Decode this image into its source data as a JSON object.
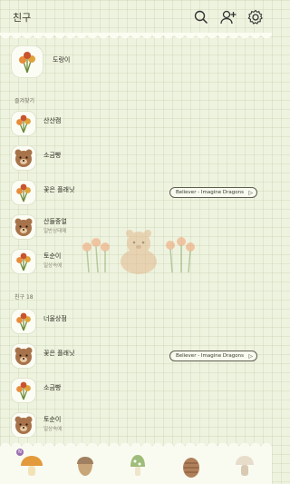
{
  "header": {
    "title": "친구"
  },
  "me": {
    "name": "도랑이"
  },
  "sections": {
    "favorites": "즐겨찾기",
    "friends": "친구 18"
  },
  "favorites": [
    {
      "name": "산산캠",
      "sub": "",
      "music": "",
      "avatar": "flower-icon"
    },
    {
      "name": "소금빵",
      "sub": "",
      "music": "",
      "avatar": "bear-icon"
    },
    {
      "name": "꽃은 플래닛",
      "sub": "",
      "music": "Believer - Imagine Dragons",
      "avatar": "flower-icon"
    },
    {
      "name": "산들중얼",
      "sub": "일반상태메",
      "music": "",
      "avatar": "bear-icon"
    },
    {
      "name": "토순이",
      "sub": "일상속에",
      "music": "",
      "avatar": "flower-icon"
    }
  ],
  "friends": [
    {
      "name": "너울상점",
      "sub": "",
      "music": "",
      "avatar": "flower-icon"
    },
    {
      "name": "꽃은 플래닛",
      "sub": "",
      "music": "Believer - Imagine Dragons",
      "avatar": "bear-icon"
    },
    {
      "name": "소금빵",
      "sub": "",
      "music": "",
      "avatar": "flower-icon"
    },
    {
      "name": "토순이",
      "sub": "일상속에",
      "music": "",
      "avatar": "bear-icon"
    }
  ],
  "nav": {
    "badge": "N",
    "items": [
      "mushroom-icon",
      "acorn-icon",
      "green-mushroom-icon",
      "pinecone-icon",
      "white-mushroom-icon"
    ]
  },
  "colors": {
    "background": "#eef3df",
    "accent": "#e0a33a",
    "bear": "#a8734a"
  }
}
